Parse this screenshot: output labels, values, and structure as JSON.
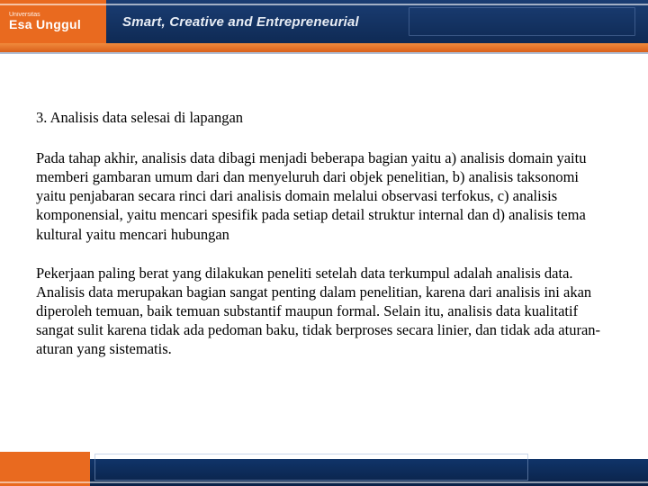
{
  "header": {
    "logo_small": "Universitas",
    "logo_main": "Esa Unggul",
    "tagline": "Smart, Creative and Entrepreneurial"
  },
  "content": {
    "heading": "3. Analisis data selesai di lapangan",
    "para1": "Pada tahap akhir, analisis data dibagi menjadi beberapa bagian yaitu a) analisis domain yaitu memberi gambaran umum dari dan menyeluruh dari objek penelitian, b) analisis taksonomi yaitu penjabaran secara rinci dari analisis domain melalui observasi terfokus, c) analisis komponensial, yaitu mencari spesifik pada setiap detail struktur internal dan d) analisis tema kultural yaitu mencari hubungan",
    "para2": "Pekerjaan paling berat yang dilakukan peneliti setelah data terkumpul adalah analisis data. Analisis data merupakan bagian sangat penting dalam penelitian, karena dari analisis ini akan diperoleh temuan, baik temuan substantif maupun formal. Selain itu, analisis data kualitatif sangat sulit karena tidak ada pedoman baku, tidak berproses secara linier, dan tidak ada aturan-aturan yang sistematis."
  }
}
